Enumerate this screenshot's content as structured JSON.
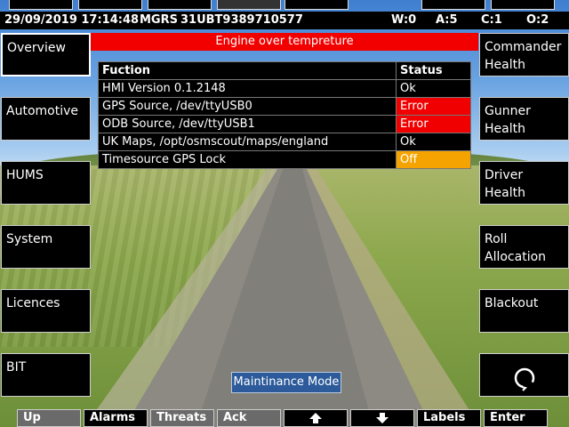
{
  "status_bar": {
    "datetime": "29/09/2019 17:14:48",
    "grid_label": "MGRS",
    "grid_value": "31UBT9389710577",
    "w": "W:0",
    "a": "A:5",
    "c": "C:1",
    "o": "O:2"
  },
  "alert": "Engine over tempreture",
  "table": {
    "headers": [
      "Fuction",
      "Status"
    ],
    "rows": [
      {
        "function": "HMI Version 0.1.2148",
        "status": "Ok"
      },
      {
        "function": "GPS Source, /dev/ttyUSB0",
        "status": "Error"
      },
      {
        "function": "ODB Source, /dev/ttyUSB1",
        "status": "Error"
      },
      {
        "function": "UK Maps, /opt/osmscout/maps/england",
        "status": "Ok"
      },
      {
        "function": "Timesource GPS Lock",
        "status": "Off"
      }
    ]
  },
  "left_menu": [
    "Overview",
    "Automotive",
    "HUMS",
    "System",
    "Licences",
    "BIT"
  ],
  "right_menu": [
    {
      "line1": "Commander",
      "line2": "Health"
    },
    {
      "line1": "Gunner",
      "line2": "Health"
    },
    {
      "line1": "Driver",
      "line2": "Health"
    },
    {
      "line1": "Roll",
      "line2": "Allocation"
    },
    {
      "line1": "Blackout",
      "line2": ""
    },
    {
      "icon": "refresh-icon"
    }
  ],
  "maintenance_button": "Maintinance Mode",
  "bottom_bar": {
    "up": "Up",
    "alarms": "Alarms",
    "threats": "Threats",
    "ack": "Ack",
    "labels": "Labels",
    "enter": "Enter",
    "up_arrow_icon": "arrow-up-icon",
    "down_arrow_icon": "arrow-down-icon"
  },
  "colors": {
    "alert": "#f20000",
    "error": "#f00000",
    "off": "#f5a300",
    "maintenance": "#2c5a9a"
  }
}
